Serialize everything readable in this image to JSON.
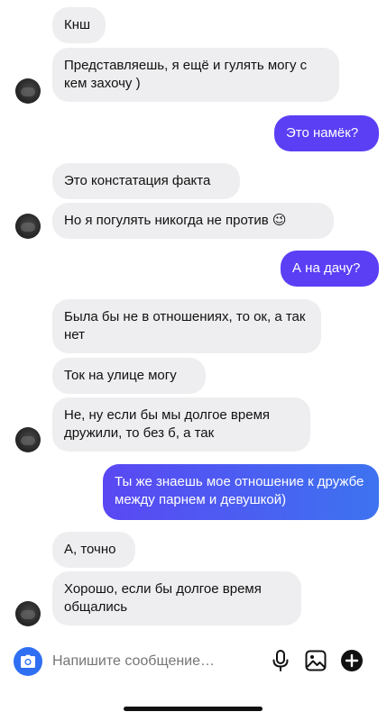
{
  "messages": [
    {
      "side": "in",
      "text": "Кнш"
    },
    {
      "side": "in",
      "text": "Представляешь, я ещё и гулять могу с кем захочу )"
    },
    {
      "side": "out",
      "text": "Это намёк?"
    },
    {
      "side": "in",
      "text": "Это констатация факта"
    },
    {
      "side": "in",
      "text": "Но я погулять никогда не против 😉"
    },
    {
      "side": "out",
      "text": "А на дачу?"
    },
    {
      "side": "in",
      "text": "Была бы не в отношениях, то ок, а так нет"
    },
    {
      "side": "in",
      "text": "Ток на улице могу"
    },
    {
      "side": "in",
      "text": "Не, ну если бы мы долгое время дружили, то без б, а так"
    },
    {
      "side": "out",
      "text": "Ты же знаешь мое отношение к дружбе между парнем и девушкой)"
    },
    {
      "side": "in",
      "text": "А, точно"
    },
    {
      "side": "in",
      "text": "Хорошо, если бы долгое время общались"
    }
  ],
  "composer": {
    "placeholder": "Напишите сообщение…",
    "icons": [
      "camera-icon",
      "microphone-icon",
      "gallery-icon",
      "plus-icon"
    ]
  },
  "colors": {
    "incoming_bg": "#eeeef0",
    "outgoing_violet": "#5a3ff5",
    "outgoing_blue": "#3f6ff0",
    "camera_button": "#2f6ff2"
  }
}
